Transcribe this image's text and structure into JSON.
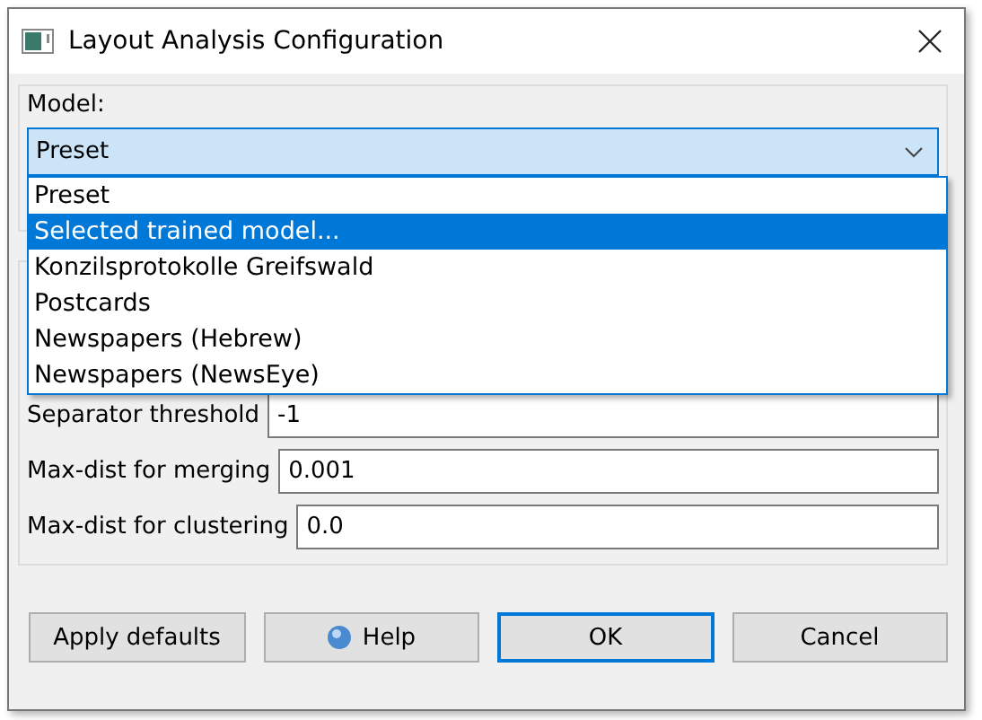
{
  "window": {
    "title": "Layout Analysis Configuration"
  },
  "model": {
    "label": "Model:",
    "value": "Preset",
    "expanded": true,
    "options": [
      {
        "label": "Preset",
        "highlighted": false
      },
      {
        "label": "Selected trained model...",
        "highlighted": true
      },
      {
        "label": "Konzilsprotokolle Greifswald",
        "highlighted": false
      },
      {
        "label": "Postcards",
        "highlighted": false
      },
      {
        "label": "Newspapers (Hebrew)",
        "highlighted": false
      },
      {
        "label": "Newspapers (NewsEye)",
        "highlighted": false
      }
    ]
  },
  "fields": [
    {
      "label": "Separator threshold",
      "value": "-1"
    },
    {
      "label": "Max-dist for merging",
      "value": "0.001"
    },
    {
      "label": "Max-dist for clustering",
      "value": "0.0"
    }
  ],
  "buttons": [
    {
      "label": "Apply defaults",
      "kind": "plain",
      "default": false
    },
    {
      "label": "Help",
      "kind": "help",
      "default": false
    },
    {
      "label": "OK",
      "kind": "plain",
      "default": true
    },
    {
      "label": "Cancel",
      "kind": "plain",
      "default": false
    }
  ]
}
